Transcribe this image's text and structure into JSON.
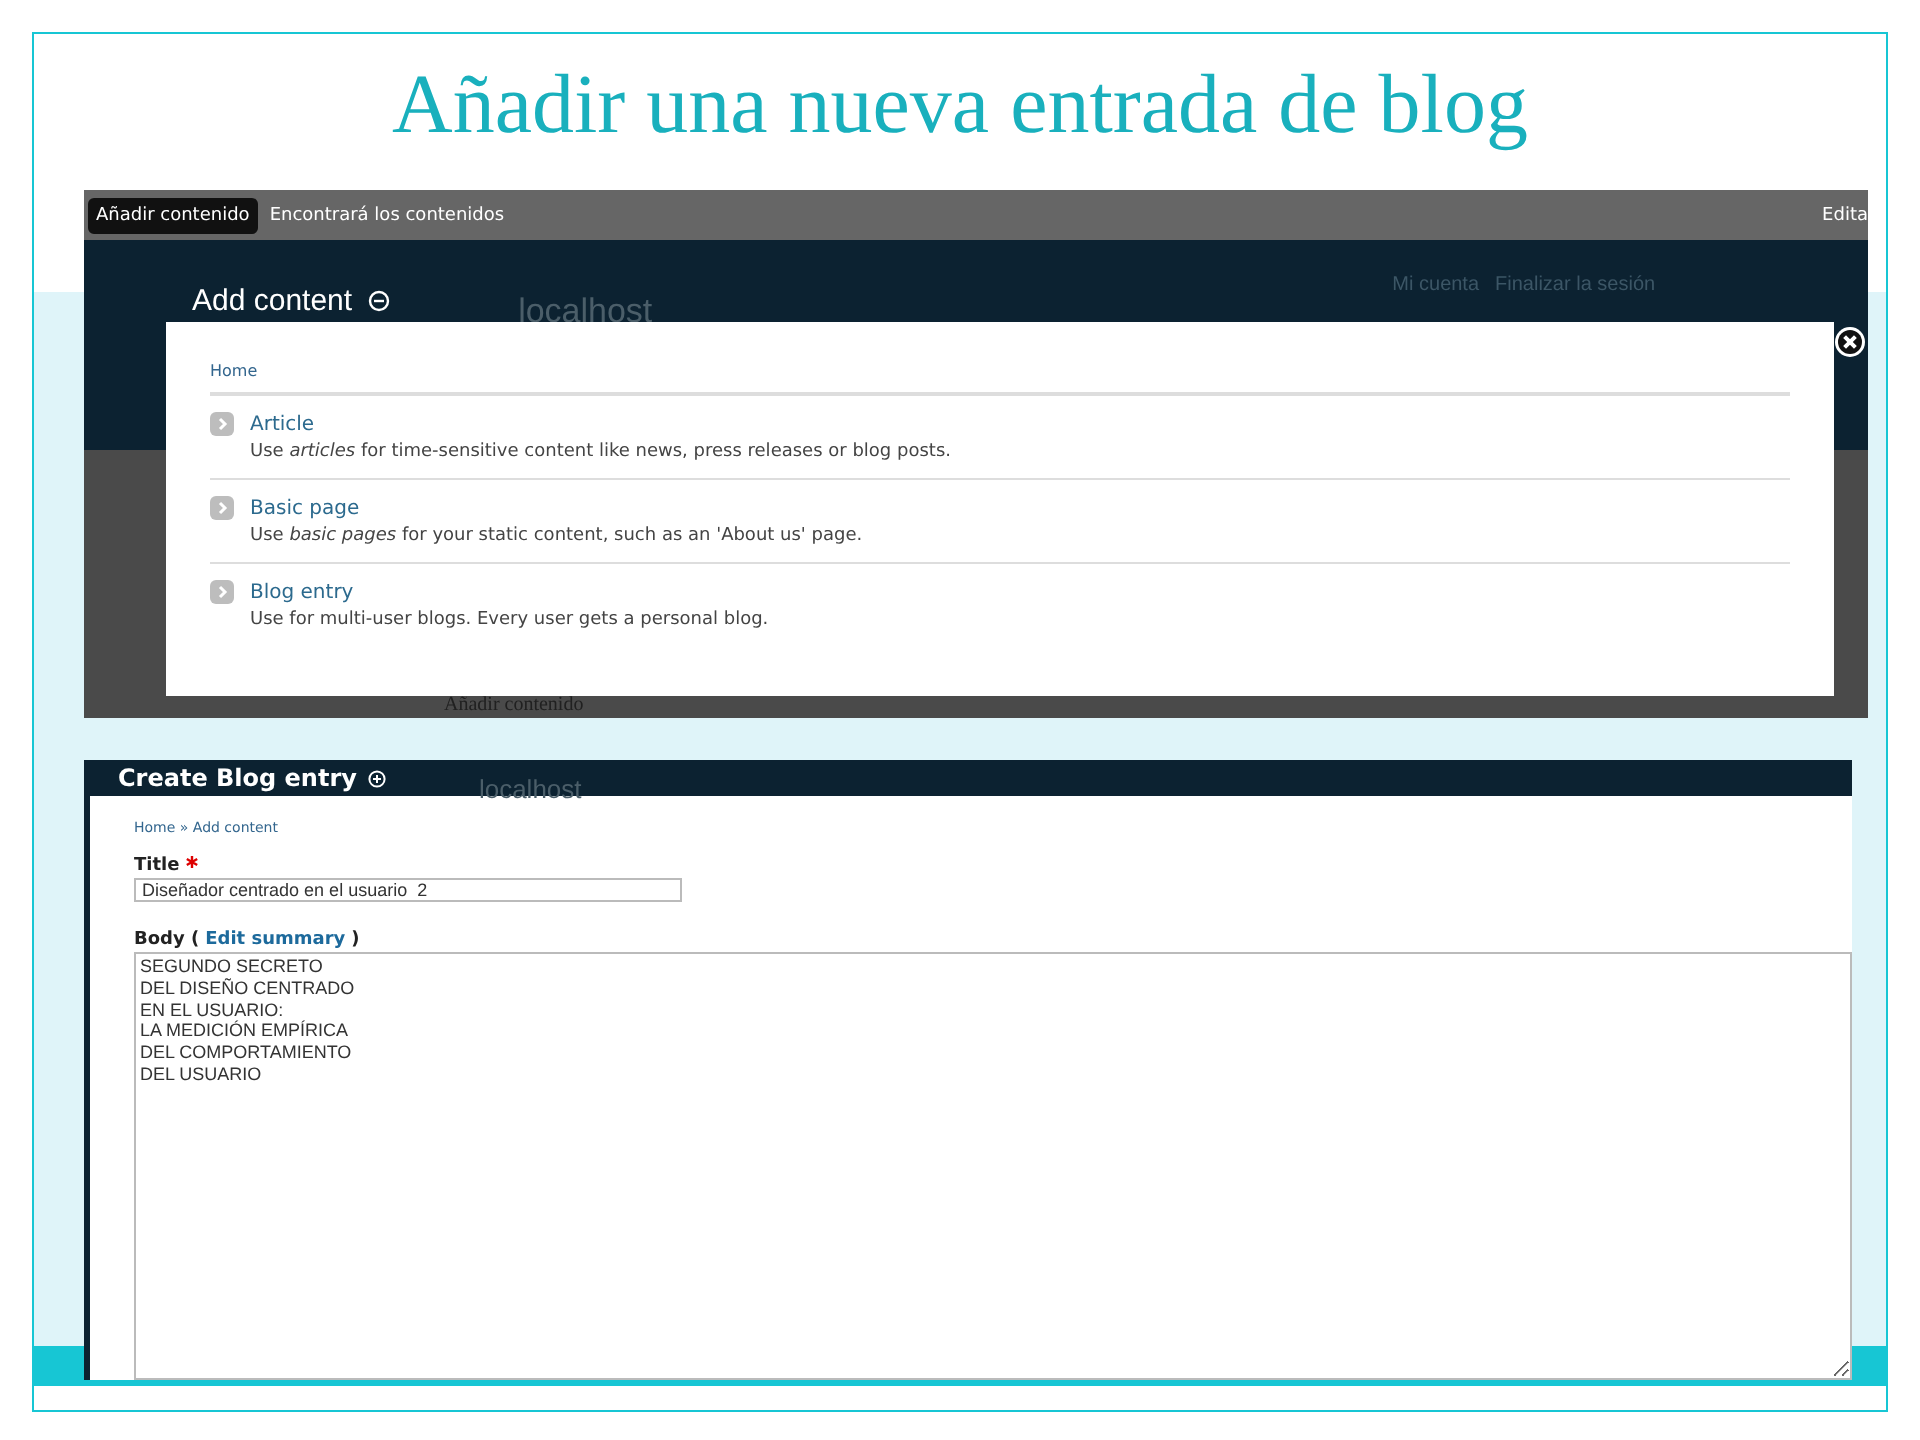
{
  "slide_title": "Añadir una nueva entrada de blog",
  "top_screenshot": {
    "toolbar": {
      "items": [
        {
          "label": "Añadir contenido",
          "selected": true
        },
        {
          "label": "Encontrará los contenidos",
          "selected": false
        }
      ],
      "edit_link": "Edita"
    },
    "header": {
      "title": "Add content",
      "site_name": "localhost",
      "user_links": [
        "Mi cuenta",
        "Finalizar la sesión"
      ]
    },
    "background_link": "Añadir contenido",
    "overlay": {
      "breadcrumb": "Home",
      "content_types": [
        {
          "name": "Article",
          "description": "Use *articles* for time-sensitive content like news, press releases or blog posts."
        },
        {
          "name": "Basic page",
          "description": "Use *basic pages* for your static content, such as an 'About us' page."
        },
        {
          "name": "Blog entry",
          "description": "Use for multi-user blogs. Every user gets a personal blog."
        }
      ]
    }
  },
  "bottom_screenshot": {
    "header": {
      "title": "Create Blog entry",
      "site_name": "localhost"
    },
    "breadcrumb": "Home » Add content",
    "title_field": {
      "label": "Title",
      "required": true,
      "value": "Diseñador centrado en el usuario  2"
    },
    "body_field": {
      "label": "Body (",
      "link": "Edit summary",
      "label_end": ")",
      "value": "SEGUNDO SECRETO\nDEL DISEÑO CENTRADO\nEN EL USUARIO:\nLA MEDICIÓN EMPÍRICA\nDEL COMPORTAMIENTO\nDEL USUARIO"
    }
  }
}
